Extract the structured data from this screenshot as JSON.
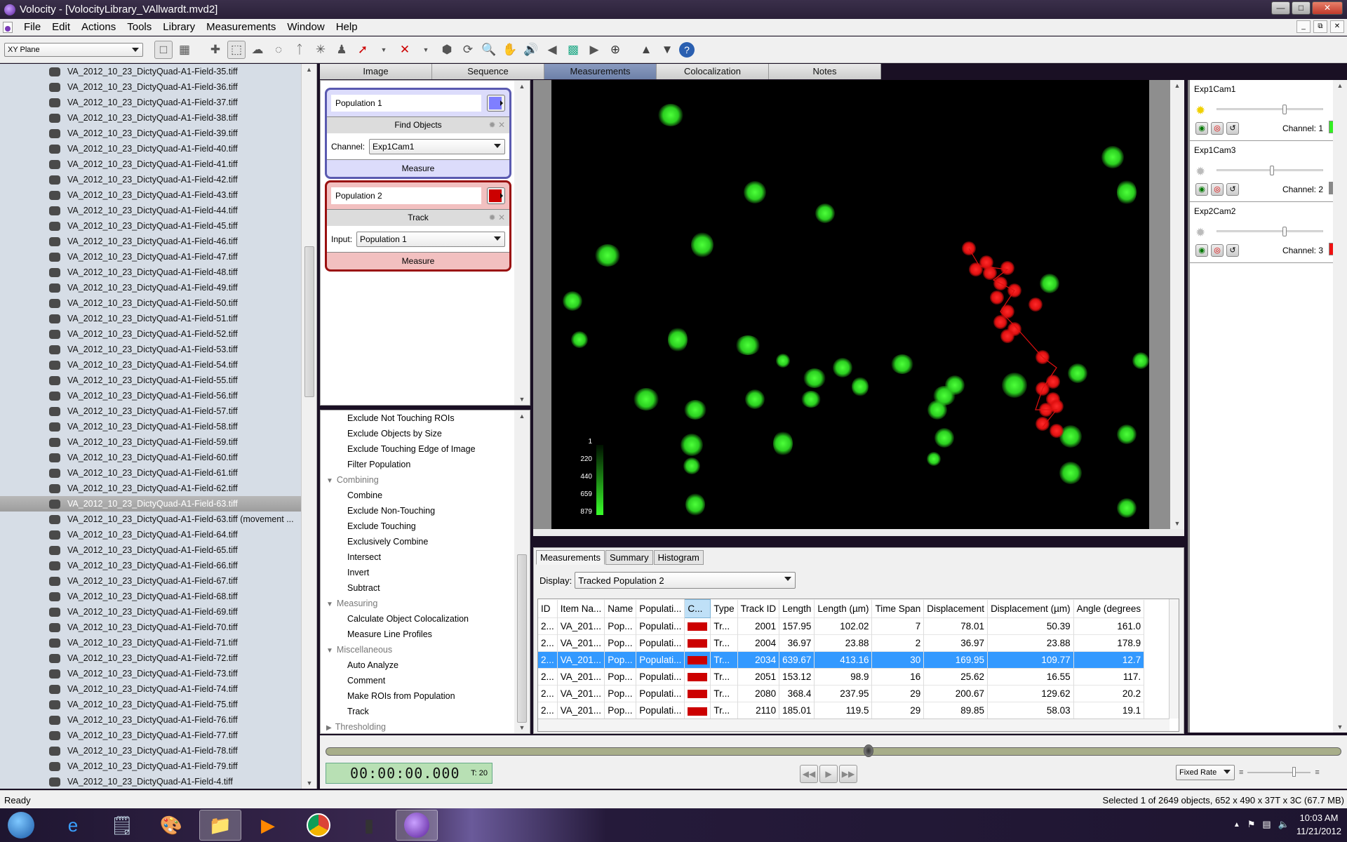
{
  "window": {
    "title": "Volocity - [VolocityLibrary_VAllwardt.mvd2]",
    "controls": [
      "minimize",
      "maximize",
      "close"
    ]
  },
  "menubar": {
    "items": [
      "File",
      "Edit",
      "Actions",
      "Tools",
      "Library",
      "Measurements",
      "Window",
      "Help"
    ]
  },
  "toolbar": {
    "view_select": "XY Plane",
    "tools": [
      "single-view-icon",
      "grid-view-icon",
      "crosshair-icon",
      "rect-select-icon",
      "freehand-select-icon",
      "ellipse-select-icon",
      "lasso-icon",
      "magic-wand-icon",
      "stamp-icon",
      "line-tool-icon",
      "delete-point-icon",
      "cube-icon",
      "rotate-3d-icon",
      "zoom-icon",
      "hand-icon",
      "flythrough-icon",
      "back-icon",
      "colocalization-icon",
      "forward-icon",
      "target-icon",
      "up-arrow-icon",
      "down-arrow-icon",
      "help-icon"
    ]
  },
  "library": {
    "items": [
      "VA_2012_10_23_DictyQuad-A1-Field-35.tiff",
      "VA_2012_10_23_DictyQuad-A1-Field-36.tiff",
      "VA_2012_10_23_DictyQuad-A1-Field-37.tiff",
      "VA_2012_10_23_DictyQuad-A1-Field-38.tiff",
      "VA_2012_10_23_DictyQuad-A1-Field-39.tiff",
      "VA_2012_10_23_DictyQuad-A1-Field-40.tiff",
      "VA_2012_10_23_DictyQuad-A1-Field-41.tiff",
      "VA_2012_10_23_DictyQuad-A1-Field-42.tiff",
      "VA_2012_10_23_DictyQuad-A1-Field-43.tiff",
      "VA_2012_10_23_DictyQuad-A1-Field-44.tiff",
      "VA_2012_10_23_DictyQuad-A1-Field-45.tiff",
      "VA_2012_10_23_DictyQuad-A1-Field-46.tiff",
      "VA_2012_10_23_DictyQuad-A1-Field-47.tiff",
      "VA_2012_10_23_DictyQuad-A1-Field-48.tiff",
      "VA_2012_10_23_DictyQuad-A1-Field-49.tiff",
      "VA_2012_10_23_DictyQuad-A1-Field-50.tiff",
      "VA_2012_10_23_DictyQuad-A1-Field-51.tiff",
      "VA_2012_10_23_DictyQuad-A1-Field-52.tiff",
      "VA_2012_10_23_DictyQuad-A1-Field-53.tiff",
      "VA_2012_10_23_DictyQuad-A1-Field-54.tiff",
      "VA_2012_10_23_DictyQuad-A1-Field-55.tiff",
      "VA_2012_10_23_DictyQuad-A1-Field-56.tiff",
      "VA_2012_10_23_DictyQuad-A1-Field-57.tiff",
      "VA_2012_10_23_DictyQuad-A1-Field-58.tiff",
      "VA_2012_10_23_DictyQuad-A1-Field-59.tiff",
      "VA_2012_10_23_DictyQuad-A1-Field-60.tiff",
      "VA_2012_10_23_DictyQuad-A1-Field-61.tiff",
      "VA_2012_10_23_DictyQuad-A1-Field-62.tiff",
      "VA_2012_10_23_DictyQuad-A1-Field-63.tiff",
      "VA_2012_10_23_DictyQuad-A1-Field-63.tiff (movement ...",
      "VA_2012_10_23_DictyQuad-A1-Field-64.tiff",
      "VA_2012_10_23_DictyQuad-A1-Field-65.tiff",
      "VA_2012_10_23_DictyQuad-A1-Field-66.tiff",
      "VA_2012_10_23_DictyQuad-A1-Field-67.tiff",
      "VA_2012_10_23_DictyQuad-A1-Field-68.tiff",
      "VA_2012_10_23_DictyQuad-A1-Field-69.tiff",
      "VA_2012_10_23_DictyQuad-A1-Field-70.tiff",
      "VA_2012_10_23_DictyQuad-A1-Field-71.tiff",
      "VA_2012_10_23_DictyQuad-A1-Field-72.tiff",
      "VA_2012_10_23_DictyQuad-A1-Field-73.tiff",
      "VA_2012_10_23_DictyQuad-A1-Field-74.tiff",
      "VA_2012_10_23_DictyQuad-A1-Field-75.tiff",
      "VA_2012_10_23_DictyQuad-A1-Field-76.tiff",
      "VA_2012_10_23_DictyQuad-A1-Field-77.tiff",
      "VA_2012_10_23_DictyQuad-A1-Field-78.tiff",
      "VA_2012_10_23_DictyQuad-A1-Field-79.tiff",
      "VA_2012_10_23_DictyQuad-A1-Field-4.tiff"
    ],
    "selected_index": 28
  },
  "tabs": {
    "items": [
      "Image",
      "Sequence",
      "Measurements",
      "Colocalization",
      "Notes"
    ],
    "active": "Measurements"
  },
  "protocol": {
    "populations": [
      {
        "name": "Population 1",
        "color": "#7f7fff",
        "step": "Find Objects",
        "param_label": "Channel:",
        "param_value": "Exp1Cam1",
        "measure_label": "Measure"
      },
      {
        "name": "Population 2",
        "color": "#cc0000",
        "step": "Track",
        "param_label": "Input:",
        "param_value": "Population 1",
        "measure_label": "Measure"
      }
    ]
  },
  "task_list": {
    "entries": [
      {
        "type": "item",
        "label": "Exclude Not Touching ROIs"
      },
      {
        "type": "item",
        "label": "Exclude Objects by Size"
      },
      {
        "type": "item",
        "label": "Exclude Touching Edge of Image"
      },
      {
        "type": "item",
        "label": "Filter Population"
      },
      {
        "type": "group",
        "label": "Combining",
        "expanded": true
      },
      {
        "type": "item",
        "label": "Combine"
      },
      {
        "type": "item",
        "label": "Exclude Non-Touching"
      },
      {
        "type": "item",
        "label": "Exclude Touching"
      },
      {
        "type": "item",
        "label": "Exclusively Combine"
      },
      {
        "type": "item",
        "label": "Intersect"
      },
      {
        "type": "item",
        "label": "Invert"
      },
      {
        "type": "item",
        "label": "Subtract"
      },
      {
        "type": "group",
        "label": "Measuring",
        "expanded": true
      },
      {
        "type": "item",
        "label": "Calculate Object Colocalization"
      },
      {
        "type": "item",
        "label": "Measure Line Profiles"
      },
      {
        "type": "group",
        "label": "Miscellaneous",
        "expanded": true
      },
      {
        "type": "item",
        "label": "Auto Analyze"
      },
      {
        "type": "item",
        "label": "Comment"
      },
      {
        "type": "item",
        "label": "Make ROIs from Population"
      },
      {
        "type": "item",
        "label": "Track"
      },
      {
        "type": "group",
        "label": "Thresholding",
        "expanded": false
      }
    ]
  },
  "image_view": {
    "lut_labels": [
      "1",
      "220",
      "440",
      "659",
      "879"
    ]
  },
  "measurements": {
    "tabs": [
      "Measurements",
      "Summary",
      "Histogram"
    ],
    "active_tab": "Measurements",
    "display_label": "Display:",
    "display_value": "Tracked Population 2",
    "columns": [
      "ID",
      "Item Na...",
      "Name",
      "Populati...",
      "C...",
      "Type",
      "Track ID",
      "Length",
      "Length (µm)",
      "Time Span",
      "Displacement",
      "Displacement (µm)",
      "Angle (degrees"
    ],
    "sorted_column": "C...",
    "rows": [
      {
        "id": "2...",
        "item": "VA_201...",
        "name": "Pop...",
        "pop": "Populati...",
        "color": "#cc0000",
        "type": "Tr...",
        "track_id": "2001",
        "length": "157.95",
        "length_um": "102.02",
        "time_span": "7",
        "disp": "78.01",
        "disp_um": "50.39",
        "angle": "161.0"
      },
      {
        "id": "2...",
        "item": "VA_201...",
        "name": "Pop...",
        "pop": "Populati...",
        "color": "#cc0000",
        "type": "Tr...",
        "track_id": "2004",
        "length": "36.97",
        "length_um": "23.88",
        "time_span": "2",
        "disp": "36.97",
        "disp_um": "23.88",
        "angle": "178.9"
      },
      {
        "id": "2...",
        "item": "VA_201...",
        "name": "Pop...",
        "pop": "Populati...",
        "color": "#cc0000",
        "type": "Tr...",
        "track_id": "2034",
        "length": "639.67",
        "length_um": "413.16",
        "time_span": "30",
        "disp": "169.95",
        "disp_um": "109.77",
        "angle": "12.7"
      },
      {
        "id": "2...",
        "item": "VA_201...",
        "name": "Pop...",
        "pop": "Populati...",
        "color": "#cc0000",
        "type": "Tr...",
        "track_id": "2051",
        "length": "153.12",
        "length_um": "98.9",
        "time_span": "16",
        "disp": "25.62",
        "disp_um": "16.55",
        "angle": "117."
      },
      {
        "id": "2...",
        "item": "VA_201...",
        "name": "Pop...",
        "pop": "Populati...",
        "color": "#cc0000",
        "type": "Tr...",
        "track_id": "2080",
        "length": "368.4",
        "length_um": "237.95",
        "time_span": "29",
        "disp": "200.67",
        "disp_um": "129.62",
        "angle": "20.2"
      },
      {
        "id": "2...",
        "item": "VA_201...",
        "name": "Pop...",
        "pop": "Populati...",
        "color": "#cc0000",
        "type": "Tr...",
        "track_id": "2110",
        "length": "185.01",
        "length_um": "119.5",
        "time_span": "29",
        "disp": "89.85",
        "disp_um": "58.03",
        "angle": "19.1"
      }
    ],
    "selected_row": 2
  },
  "channels": [
    {
      "name": "Exp1Cam1",
      "label": "Channel: 1",
      "color": "#33ee22",
      "active": true,
      "slider": 0.62
    },
    {
      "name": "Exp1Cam3",
      "label": "Channel: 2",
      "color": "#888888",
      "active": false,
      "slider": 0.5
    },
    {
      "name": "Exp2Cam2",
      "label": "Channel: 3",
      "color": "#ee1111",
      "active": false,
      "slider": 0.62
    }
  ],
  "timeline": {
    "time": "00:00:00.000",
    "timepoint": "T: 20",
    "position": 0.53,
    "rate_mode": "Fixed Rate"
  },
  "status": {
    "left": "Ready",
    "right": "Selected 1 of 2649 objects, 652 x 490 x 37T x 3C (67.7 MB)"
  },
  "taskbar": {
    "apps": [
      "start-orb",
      "internet-explorer",
      "notepad",
      "paint",
      "file-explorer",
      "media-player",
      "chrome",
      "server-app",
      "volocity"
    ],
    "time": "10:03 AM",
    "date": "11/21/2012"
  }
}
